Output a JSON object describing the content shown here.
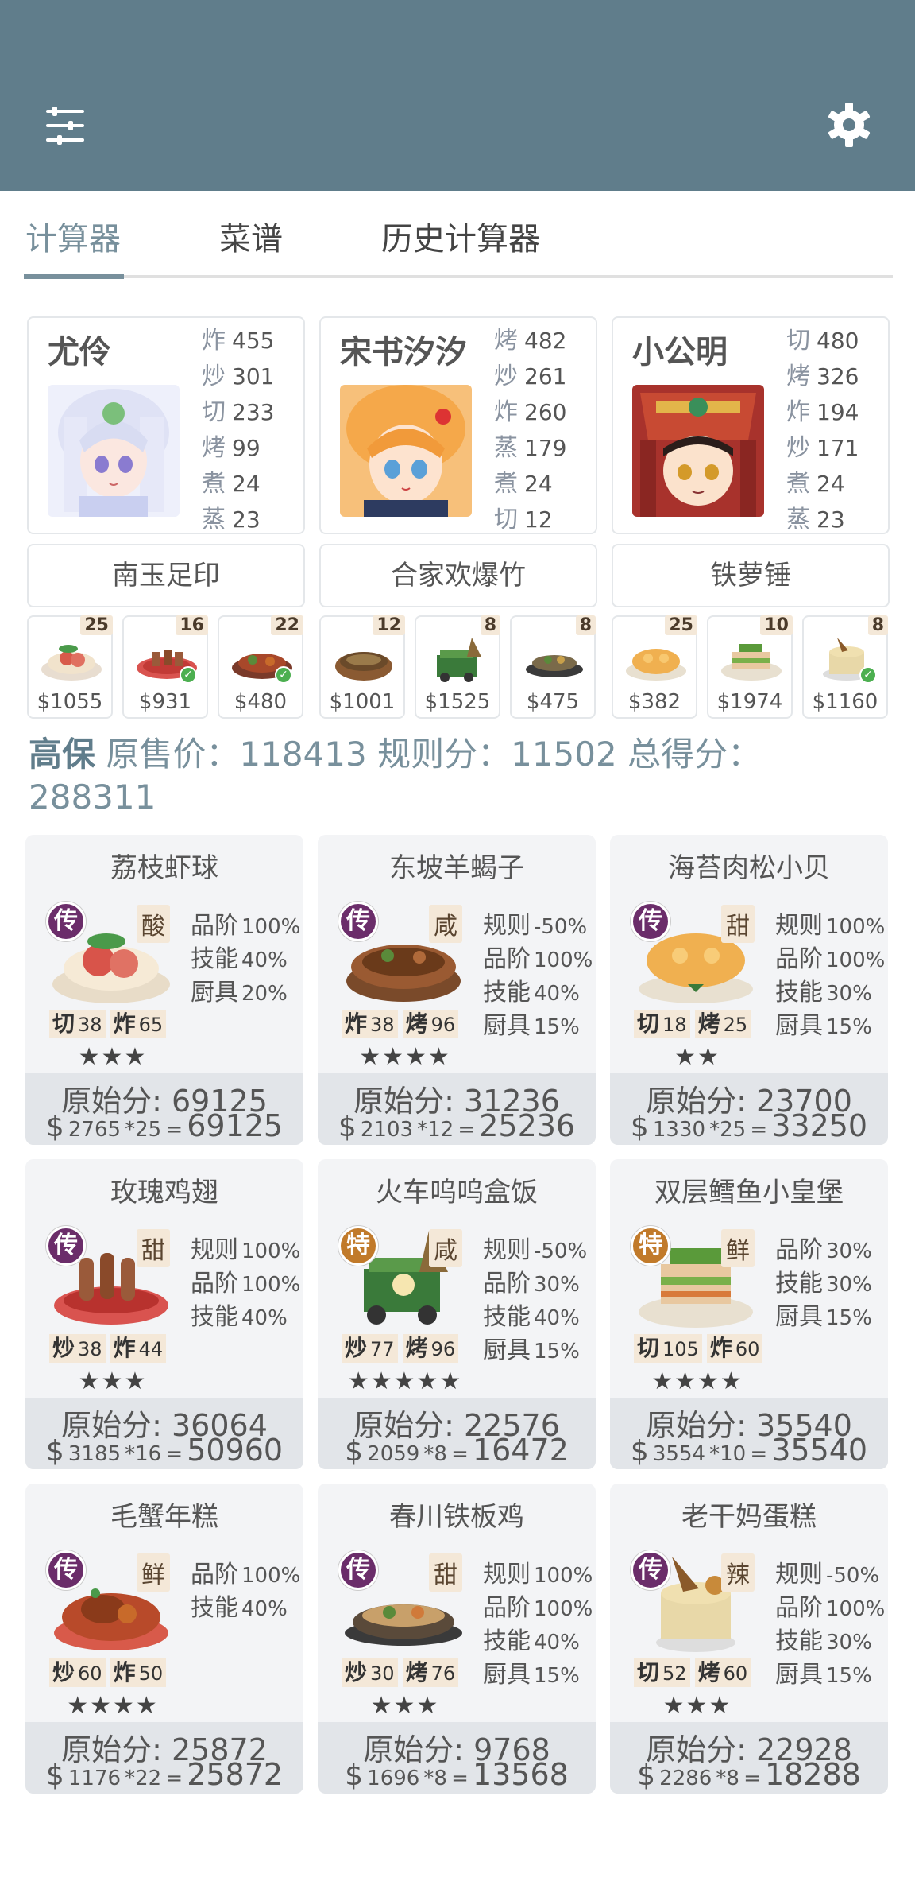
{
  "tabs": [
    "计算器",
    "菜谱",
    "历史计算器"
  ],
  "chefs": [
    {
      "name": "尤伶",
      "stats": [
        [
          "炸",
          "455"
        ],
        [
          "炒",
          "301"
        ],
        [
          "切",
          "233"
        ],
        [
          "烤",
          "99"
        ],
        [
          "煮",
          "24"
        ],
        [
          "蒸",
          "23"
        ]
      ],
      "equip": "南玉足印"
    },
    {
      "name": "宋书汐汐",
      "stats": [
        [
          "烤",
          "482"
        ],
        [
          "炒",
          "261"
        ],
        [
          "炸",
          "260"
        ],
        [
          "蒸",
          "179"
        ],
        [
          "煮",
          "24"
        ],
        [
          "切",
          "12"
        ]
      ],
      "equip": "合家欢爆竹"
    },
    {
      "name": "小公明",
      "stats": [
        [
          "切",
          "480"
        ],
        [
          "烤",
          "326"
        ],
        [
          "炸",
          "194"
        ],
        [
          "炒",
          "171"
        ],
        [
          "煮",
          "24"
        ],
        [
          "蒸",
          "23"
        ]
      ],
      "equip": "铁萝锤"
    }
  ],
  "strip": [
    {
      "count": "25",
      "price": "$1055",
      "check": false
    },
    {
      "count": "16",
      "price": "$931",
      "check": true
    },
    {
      "count": "22",
      "price": "$480",
      "check": true
    },
    {
      "count": "12",
      "price": "$1001",
      "check": false
    },
    {
      "count": "8",
      "price": "$1525",
      "check": false
    },
    {
      "count": "8",
      "price": "$475",
      "check": false
    },
    {
      "count": "25",
      "price": "$382",
      "check": false
    },
    {
      "count": "10",
      "price": "$1974",
      "check": false
    },
    {
      "count": "8",
      "price": "$1160",
      "check": true
    }
  ],
  "summary": {
    "name": "高保",
    "orig_label": "原售价：",
    "orig": "118413",
    "rule_label": "规则分：",
    "rule": "11502",
    "total_label": "总得分：",
    "total": "288311"
  },
  "recipes": [
    {
      "title": "荔枝虾球",
      "rarity": "传",
      "flavor": "酸",
      "skills": [
        [
          "切",
          "38"
        ],
        [
          "炸",
          "65"
        ]
      ],
      "stars": "★★★",
      "mods": [
        [
          "品阶",
          "100%"
        ],
        [
          "技能",
          "40%"
        ],
        [
          "厨具",
          "20%"
        ]
      ],
      "raw": "原始分: 69125",
      "price": "2765",
      "mult": "*25",
      "score": "69125"
    },
    {
      "title": "东坡羊蝎子",
      "rarity": "传",
      "flavor": "咸",
      "skills": [
        [
          "炸",
          "38"
        ],
        [
          "烤",
          "96"
        ]
      ],
      "stars": "★★★★",
      "mods": [
        [
          "规则",
          "-50%"
        ],
        [
          "品阶",
          "100%"
        ],
        [
          "技能",
          "40%"
        ],
        [
          "厨具",
          "15%"
        ]
      ],
      "raw": "原始分: 31236",
      "price": "2103",
      "mult": "*12",
      "score": "25236"
    },
    {
      "title": "海苔肉松小贝",
      "rarity": "传",
      "flavor": "甜",
      "skills": [
        [
          "切",
          "18"
        ],
        [
          "烤",
          "25"
        ]
      ],
      "stars": "★★",
      "mods": [
        [
          "规则",
          "100%"
        ],
        [
          "品阶",
          "100%"
        ],
        [
          "技能",
          "30%"
        ],
        [
          "厨具",
          "15%"
        ]
      ],
      "raw": "原始分: 23700",
      "price": "1330",
      "mult": "*25",
      "score": "33250"
    },
    {
      "title": "玫瑰鸡翅",
      "rarity": "传",
      "flavor": "甜",
      "skills": [
        [
          "炒",
          "38"
        ],
        [
          "炸",
          "44"
        ]
      ],
      "stars": "★★★",
      "mods": [
        [
          "规则",
          "100%"
        ],
        [
          "品阶",
          "100%"
        ],
        [
          "技能",
          "40%"
        ]
      ],
      "raw": "原始分: 36064",
      "price": "3185",
      "mult": "*16",
      "score": "50960"
    },
    {
      "title": "火车呜呜盒饭",
      "rarity": "特",
      "flavor": "咸",
      "skills": [
        [
          "炒",
          "77"
        ],
        [
          "烤",
          "96"
        ]
      ],
      "stars": "★★★★★",
      "mods": [
        [
          "规则",
          "-50%"
        ],
        [
          "品阶",
          "30%"
        ],
        [
          "技能",
          "40%"
        ],
        [
          "厨具",
          "15%"
        ]
      ],
      "raw": "原始分: 22576",
      "price": "2059",
      "mult": "*8",
      "score": "16472"
    },
    {
      "title": "双层鳕鱼小皇堡",
      "rarity": "特",
      "flavor": "鲜",
      "skills": [
        [
          "切",
          "105"
        ],
        [
          "炸",
          "60"
        ]
      ],
      "stars": "★★★★",
      "mods": [
        [
          "品阶",
          "30%"
        ],
        [
          "技能",
          "30%"
        ],
        [
          "厨具",
          "15%"
        ]
      ],
      "raw": "原始分: 35540",
      "price": "3554",
      "mult": "*10",
      "score": "35540"
    },
    {
      "title": "毛蟹年糕",
      "rarity": "传",
      "flavor": "鲜",
      "skills": [
        [
          "炒",
          "60"
        ],
        [
          "炸",
          "50"
        ]
      ],
      "stars": "★★★★",
      "mods": [
        [
          "品阶",
          "100%"
        ],
        [
          "技能",
          "40%"
        ]
      ],
      "raw": "原始分: 25872",
      "price": "1176",
      "mult": "*22",
      "score": "25872"
    },
    {
      "title": "春川铁板鸡",
      "rarity": "传",
      "flavor": "甜",
      "skills": [
        [
          "炒",
          "30"
        ],
        [
          "烤",
          "76"
        ]
      ],
      "stars": "★★★",
      "mods": [
        [
          "规则",
          "100%"
        ],
        [
          "品阶",
          "100%"
        ],
        [
          "技能",
          "40%"
        ],
        [
          "厨具",
          "15%"
        ]
      ],
      "raw": "原始分: 9768",
      "price": "1696",
      "mult": "*8",
      "score": "13568"
    },
    {
      "title": "老干妈蛋糕",
      "rarity": "传",
      "flavor": "辣",
      "skills": [
        [
          "切",
          "52"
        ],
        [
          "烤",
          "60"
        ]
      ],
      "stars": "★★★",
      "mods": [
        [
          "规则",
          "-50%"
        ],
        [
          "品阶",
          "100%"
        ],
        [
          "技能",
          "30%"
        ],
        [
          "厨具",
          "15%"
        ]
      ],
      "raw": "原始分: 22928",
      "price": "2286",
      "mult": "*8",
      "score": "18288"
    }
  ]
}
